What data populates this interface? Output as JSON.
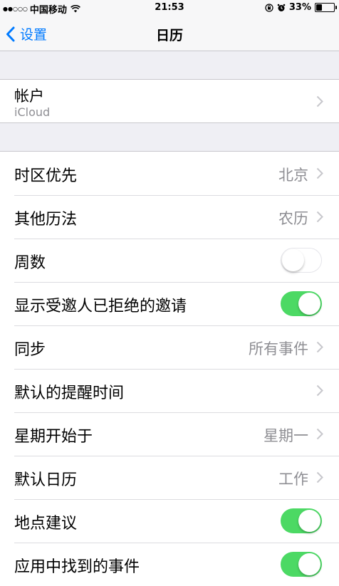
{
  "status_bar": {
    "signal": "●●○○○",
    "carrier": "中国移动",
    "time": "21:53",
    "battery": "33%",
    "battery_level": 0.33
  },
  "nav": {
    "back_label": "设置",
    "title": "日历"
  },
  "account": {
    "title": "帐户",
    "subtitle": "iCloud"
  },
  "settings": {
    "rows": [
      {
        "label": "时区优先",
        "value": "北京"
      },
      {
        "label": "其他历法",
        "value": "农历"
      },
      {
        "label": "周数",
        "toggle": false
      },
      {
        "label": "显示受邀人已拒绝的邀请",
        "toggle": true
      },
      {
        "label": "同步",
        "value": "所有事件"
      },
      {
        "label": "默认的提醒时间",
        "value": ""
      },
      {
        "label": "星期开始于",
        "value": "星期一"
      },
      {
        "label": "默认日历",
        "value": "工作"
      },
      {
        "label": "地点建议",
        "toggle": true
      },
      {
        "label": "应用中找到的事件",
        "toggle": true
      }
    ]
  },
  "colors": {
    "accent": "#007aff",
    "toggle_on": "#4cd964",
    "background": "#efeff4"
  }
}
